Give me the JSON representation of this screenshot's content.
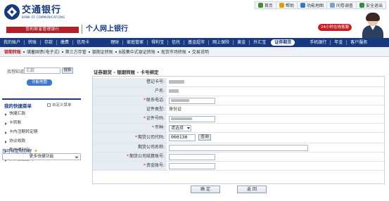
{
  "brand": {
    "name_cn": "交通银行",
    "name_en": "BANK OF COMMUNICATIONS",
    "slogan": "您的财富管理银行",
    "site_title": "个人网上银行",
    "color": "#17397f",
    "accent": "#b3202a"
  },
  "top_links": [
    {
      "label": "首页",
      "icon": "home-icon",
      "color": "#4d8a2f"
    },
    {
      "label": "帮助",
      "icon": "help-icon",
      "color": "#e0a100"
    },
    {
      "label": "功能地图",
      "icon": "map-icon",
      "color": "#3b78c4"
    },
    {
      "label": "问卷调查",
      "icon": "survey-icon",
      "color": "#7aa0c8"
    },
    {
      "label": "安全退出",
      "icon": "logout-icon",
      "color": "#2f8f3e"
    }
  ],
  "service_badge": "24小时在线客服",
  "main_nav": [
    "我的账户",
    "转账",
    "存款",
    "缴费",
    "信用卡",
    "理财",
    "家庭管家",
    "得利宝",
    "信托",
    "基金超市",
    "网上保险",
    "黄金",
    "外汇宝",
    "证券期货",
    "手机银行",
    "年金",
    "客户服务"
  ],
  "main_nav_active": "证券期货",
  "sub_nav": [
    "银期转账",
    "储蓄国债(电子式)",
    "第三方存管",
    "银期证转账",
    "B股集中式银证转账",
    "现货市场转账",
    "交易说明"
  ],
  "sub_nav_active": "银期转账",
  "search": {
    "label": "我想知道:",
    "placeholder": "汇款",
    "button": "搜索",
    "map_button": "功能地图"
  },
  "quick_menu": {
    "title": "我的快捷菜单",
    "custom": "自定义菜单",
    "items": [
      "快捷汇款",
      "卡转账",
      "卡内活期转定期",
      "协议收款",
      "我的得利宝",
      "债券基金查询"
    ],
    "link": "您可以定制办理",
    "more": "更多快捷功能"
  },
  "form": {
    "title": "证券期货 - 银期转账 - 卡号绑定",
    "rows": [
      {
        "label": "借记卡号:",
        "required": false,
        "value": "",
        "masked": true
      },
      {
        "label": "户名:",
        "required": false,
        "value": "",
        "masked": true
      },
      {
        "label": "联系电话:",
        "required": true,
        "value": "",
        "masked": true,
        "input": true
      },
      {
        "label": "证件类型:",
        "required": false,
        "value": "身份证",
        "masked": false
      },
      {
        "label": "证件号码:",
        "required": true,
        "value": "",
        "masked": true,
        "input": true
      },
      {
        "label": "币种:",
        "required": true,
        "value": "请选择",
        "select": true
      },
      {
        "label": "期货公司代码:",
        "required": true,
        "value": "000130",
        "input": true,
        "button": "查询"
      },
      {
        "label": "期货公司名称:",
        "required": false,
        "value": "",
        "input": true
      },
      {
        "label": "期货公司结算账号:",
        "required": true,
        "value": "",
        "input": true
      },
      {
        "label": "资金账号:",
        "required": true,
        "value": "",
        "input": true
      }
    ],
    "confirm": "确 定",
    "back": "返 回"
  }
}
